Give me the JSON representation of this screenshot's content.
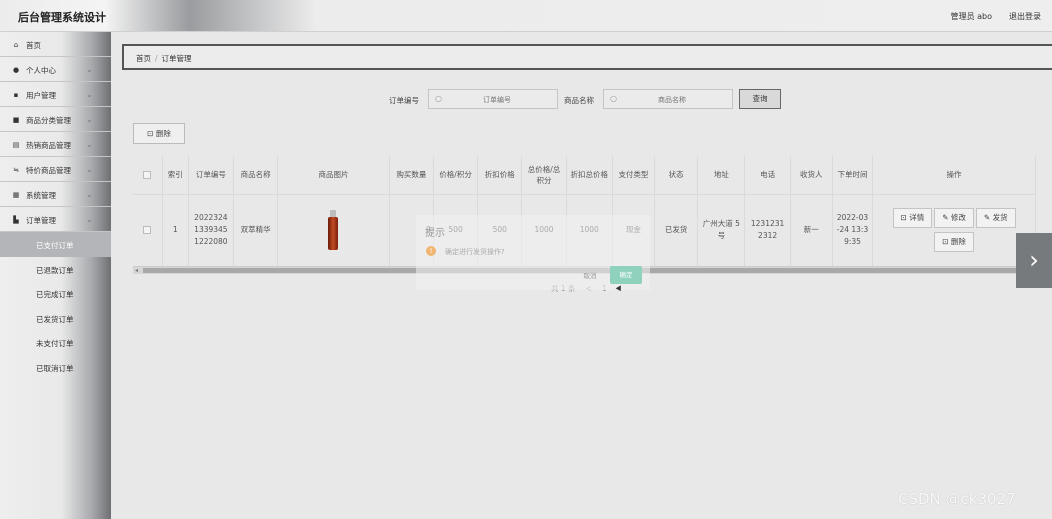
{
  "header": {
    "title": "后台管理系统设计",
    "admin": "管理员 abo",
    "logout": "退出登录"
  },
  "sidebar": {
    "items": [
      {
        "label": "首页",
        "icon": "home-icon"
      },
      {
        "label": "个人中心",
        "icon": "user-icon"
      },
      {
        "label": "用户管理",
        "icon": "users-icon"
      },
      {
        "label": "商品分类管理",
        "icon": "category-icon"
      },
      {
        "label": "热销商品管理",
        "icon": "hot-goods-icon"
      },
      {
        "label": "特价商品管理",
        "icon": "discount-goods-icon"
      },
      {
        "label": "系统管理",
        "icon": "grid-icon"
      },
      {
        "label": "订单管理",
        "icon": "cart-icon"
      }
    ],
    "submenu": [
      "已支付订单",
      "已退款订单",
      "已完成订单",
      "已发货订单",
      "未支付订单",
      "已取消订单"
    ]
  },
  "breadcrumb": {
    "home": "首页",
    "separator": "/",
    "current": "订单管理"
  },
  "search": {
    "order_label": "订单编号",
    "order_placeholder": "订单编号",
    "product_label": "商品名称",
    "product_placeholder": "商品名称",
    "query_button": "查询"
  },
  "toolbar": {
    "delete_button": "删除"
  },
  "table": {
    "headers": [
      "索引",
      "订单编号",
      "商品名称",
      "商品图片",
      "购买数量",
      "价格/积分",
      "折扣价格",
      "总价格/总积分",
      "折扣总价格",
      "支付类型",
      "状态",
      "地址",
      "电话",
      "收货人",
      "下单时间",
      "操作"
    ],
    "row": {
      "index": "1",
      "order_no": "2022324 1339345 1222080",
      "product_name": "双萃精华",
      "quantity": "2",
      "price": "500",
      "discount_price": "500",
      "total_price": "1000",
      "discount_total": "1000",
      "pay_type": "现金",
      "status": "已发货",
      "address": "广州大道 5号",
      "phone": "1231231 2312",
      "receiver": "新一",
      "order_time": "2022-03 -24 13:3 9:35"
    },
    "actions": {
      "detail": "详情",
      "edit": "修改",
      "ship": "发货",
      "delete": "删除"
    }
  },
  "pagination": {
    "total": "共 1 条",
    "prev": "<",
    "page": "1",
    "next": ">"
  },
  "modal": {
    "title": "提示",
    "message": "确定进行发货操作?",
    "cancel": "取消",
    "confirm": "确定"
  },
  "watermark": "CSDN @ck3027",
  "colors": {
    "active_menu": "#b3b5b8",
    "confirm_button": "#8ed1bd",
    "warning": "#f0b570"
  }
}
